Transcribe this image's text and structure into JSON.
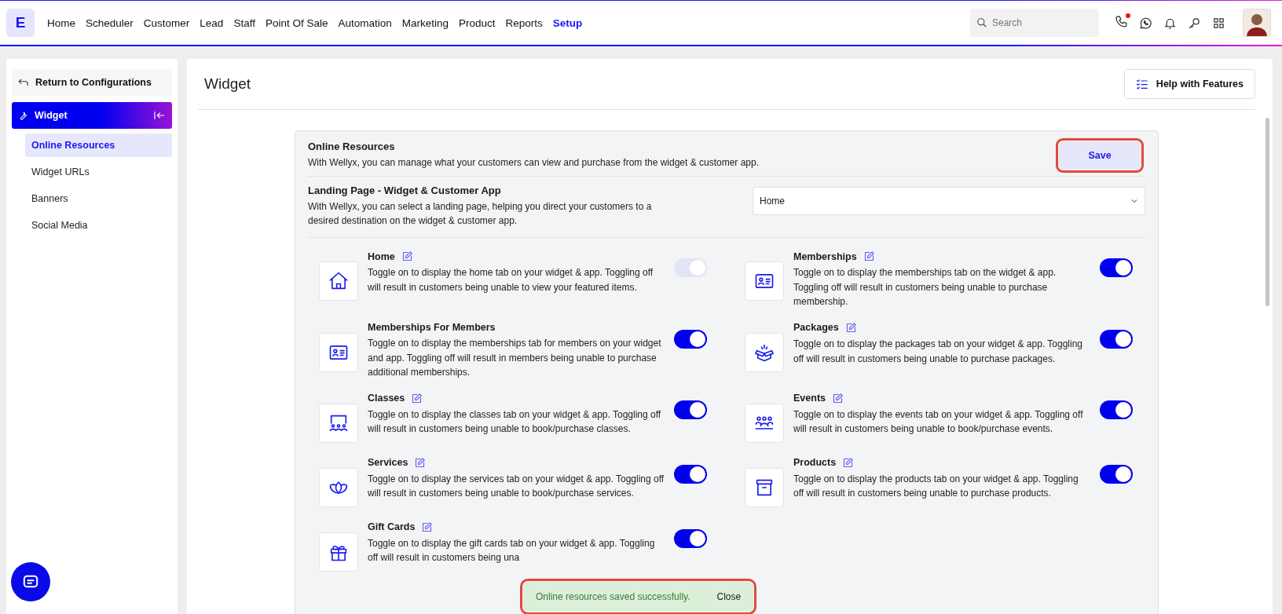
{
  "nav": {
    "logo": "E",
    "items": [
      {
        "label": "Home",
        "selected": false
      },
      {
        "label": "Scheduler",
        "selected": false
      },
      {
        "label": "Customer",
        "selected": false
      },
      {
        "label": "Lead",
        "selected": false
      },
      {
        "label": "Staff",
        "selected": false
      },
      {
        "label": "Point Of Sale",
        "selected": false
      },
      {
        "label": "Automation",
        "selected": false
      },
      {
        "label": "Marketing",
        "selected": false
      },
      {
        "label": "Product",
        "selected": false
      },
      {
        "label": "Reports",
        "selected": false
      },
      {
        "label": "Setup",
        "selected": true
      }
    ],
    "search": {
      "placeholder": "Search"
    },
    "call_notification": true
  },
  "sidebar": {
    "back": "Return to Configurations",
    "section": "Widget",
    "items": [
      {
        "label": "Online Resources",
        "selected": true
      },
      {
        "label": "Widget URLs",
        "selected": false
      },
      {
        "label": "Banners",
        "selected": false
      },
      {
        "label": "Social Media",
        "selected": false
      }
    ]
  },
  "page": {
    "title": "Widget",
    "help_button": "Help with Features"
  },
  "card": {
    "title": "Online Resources",
    "description": "With Wellyx, you can manage what your customers can view and purchase from the widget & customer app.",
    "save_button": {
      "label": "Save",
      "highlighted": true
    },
    "landing": {
      "title": "Landing Page - Widget & Customer App",
      "description": "With Wellyx, you can select a landing page, helping you direct your customers to a desired destination on the widget & customer app.",
      "value": "Home"
    }
  },
  "resources": [
    {
      "kind": "home",
      "title": "Home",
      "description": "Toggle on to display the home tab on your widget & app. Toggling off will result in customers being unable to view your featured items.",
      "on": true,
      "disabled": true,
      "editable": true
    },
    {
      "kind": "card",
      "title": "Memberships",
      "description": "Toggle on to display the memberships tab on the widget & app. Toggling off will result in customers being unable to purchase membership.",
      "on": true,
      "disabled": false,
      "editable": true
    },
    {
      "kind": "card",
      "title": "Memberships For Members",
      "description": "Toggle on to display the memberships tab for members on your widget and app. Toggling off will result in members being unable to purchase additional memberships.",
      "on": true,
      "disabled": false,
      "editable": false
    },
    {
      "kind": "box",
      "title": "Packages",
      "description": "Toggle on to display the packages tab on your widget & app. Toggling off will result in customers being unable to purchase packages.",
      "on": true,
      "disabled": false,
      "editable": true
    },
    {
      "kind": "class",
      "title": "Classes",
      "description": "Toggle on to display the classes tab on your widget & app. Toggling off will result in customers being unable to book/purchase classes.",
      "on": true,
      "disabled": false,
      "editable": true
    },
    {
      "kind": "group",
      "title": "Events",
      "description": "Toggle on to display the events tab on your widget & app. Toggling off will result in customers being unable to book/purchase events.",
      "on": true,
      "disabled": false,
      "editable": true
    },
    {
      "kind": "lotus",
      "title": "Services",
      "description": "Toggle on to display the services tab on your widget & app. Toggling off will result in customers being unable to book/purchase services.",
      "on": true,
      "disabled": false,
      "editable": true
    },
    {
      "kind": "archive",
      "title": "Products",
      "description": "Toggle on to display the products tab on your widget & app. Toggling off will result in customers being unable to purchase products.",
      "on": true,
      "disabled": false,
      "editable": true
    },
    {
      "kind": "gift",
      "title": "Gift Cards",
      "description": "Toggle on to display the gift cards tab on your widget & app. Toggling off will result in customers being una",
      "on": true,
      "disabled": false,
      "editable": true
    }
  ],
  "toast": {
    "message": "Online resources saved successfully.",
    "close": "Close",
    "highlighted": true
  }
}
